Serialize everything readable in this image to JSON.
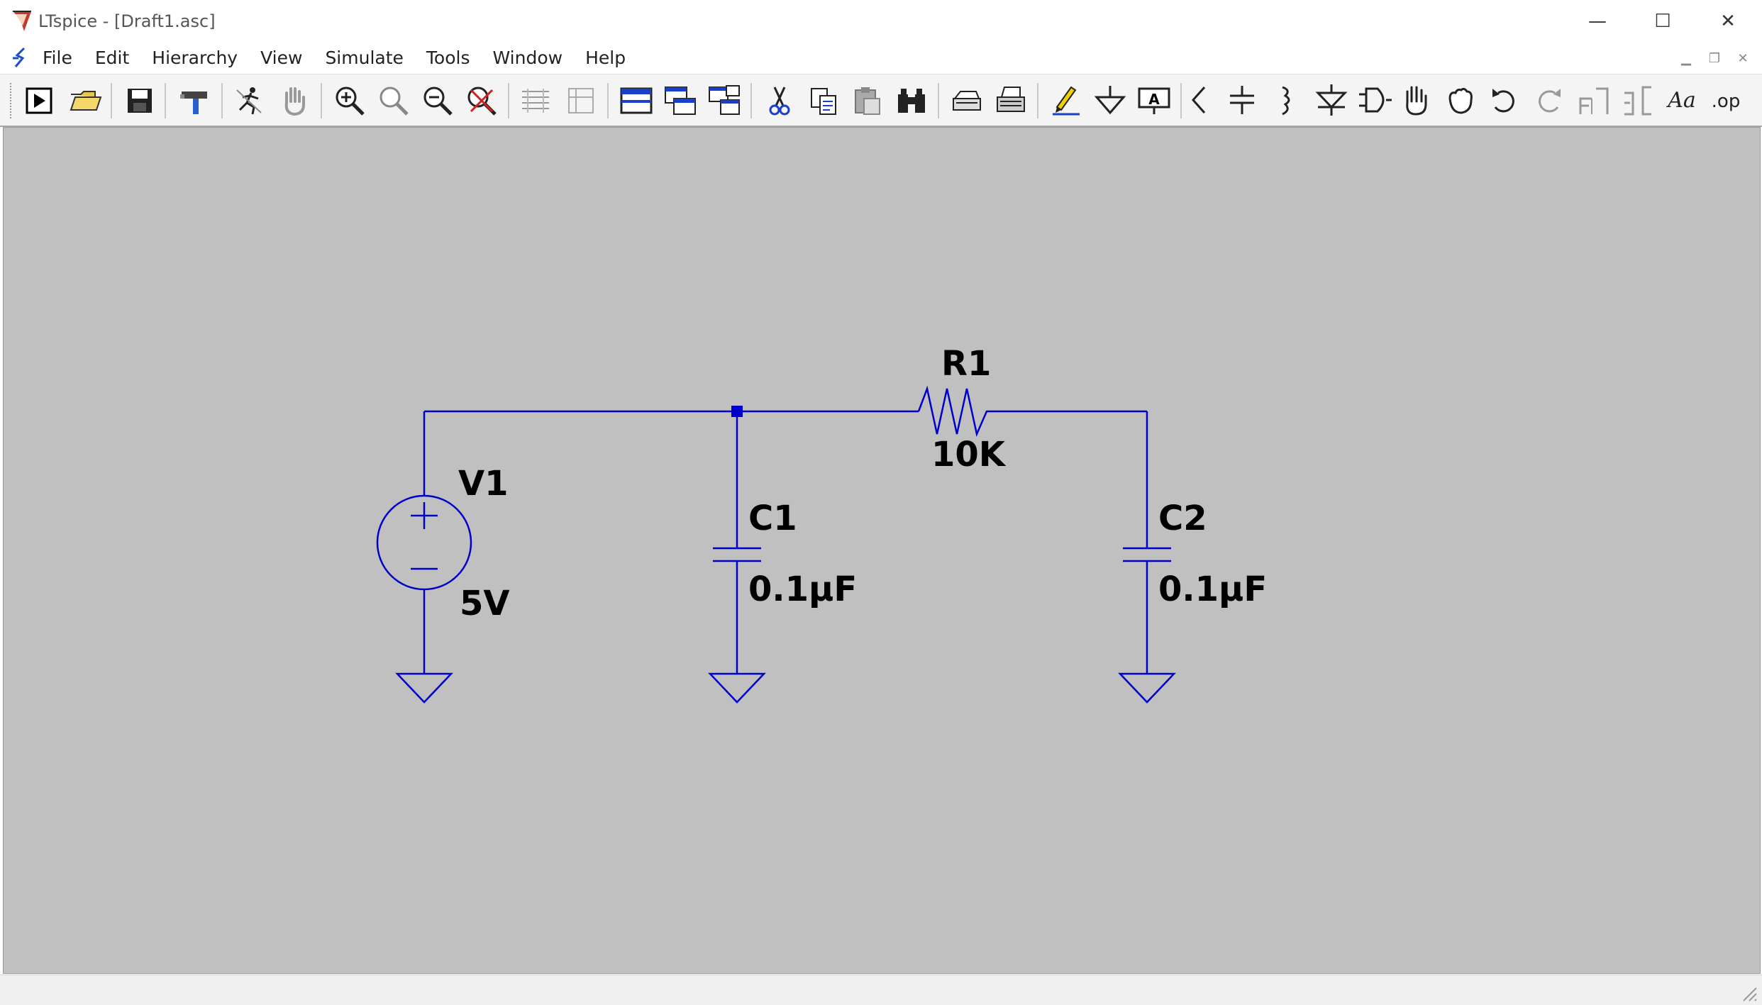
{
  "window": {
    "title": "LTspice - [Draft1.asc]",
    "minimize": "—",
    "maximize": "☐",
    "close": "✕"
  },
  "menu": {
    "items": [
      "File",
      "Edit",
      "Hierarchy",
      "View",
      "Simulate",
      "Tools",
      "Window",
      "Help"
    ],
    "mdi_minimize": "▁",
    "mdi_restore": "❐",
    "mdi_close": "✕"
  },
  "toolbar": {
    "buttons": [
      "run-icon",
      "open-folder-icon",
      "save-icon",
      "control-panel-icon",
      "halt-icon",
      "pan-hand-icon",
      "zoom-in-icon",
      "zoom-area-icon",
      "zoom-out-icon",
      "zoom-fit-icon",
      "tile-horizontal-icon",
      "tile-vertical-icon",
      "cascade-icon",
      "tile-icon",
      "arrange-icon",
      "cut-icon",
      "copy-icon",
      "paste-icon",
      "find-icon",
      "print-preview-icon",
      "print-icon",
      "draw-wire-icon",
      "ground-icon",
      "net-label-icon",
      "resistor-icon",
      "capacitor-icon",
      "inductor-icon",
      "diode-icon",
      "component-icon",
      "move-icon",
      "drag-icon",
      "undo-icon",
      "redo-icon",
      "rotate-icon",
      "mirror-icon",
      "text-icon",
      "spice-directive-icon"
    ],
    "text_button": "Aa",
    "op_button": ".op"
  },
  "schematic": {
    "wire_color": "#0000cc",
    "background": "#c0c0c0",
    "components": {
      "v1": {
        "name": "V1",
        "value": "5V"
      },
      "c1": {
        "name": "C1",
        "value": "0.1µF"
      },
      "r1": {
        "name": "R1",
        "value": "10K"
      },
      "c2": {
        "name": "C2",
        "value": "0.1µF"
      }
    }
  },
  "status": {
    "text": ""
  }
}
